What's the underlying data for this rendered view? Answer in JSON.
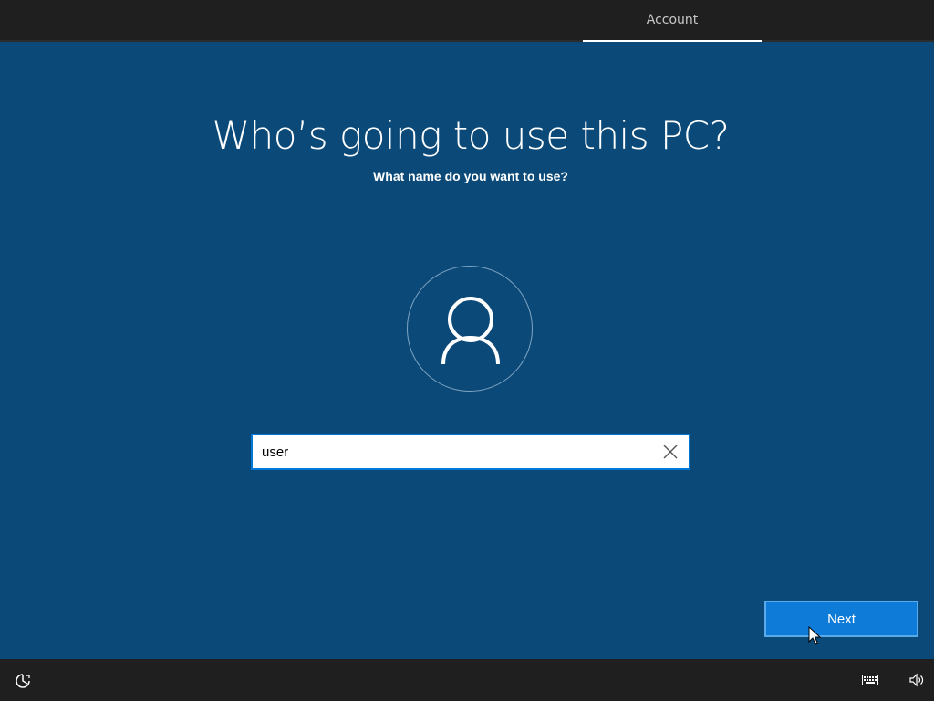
{
  "header": {
    "tabs": [
      {
        "label": "Account",
        "active": true
      }
    ]
  },
  "main": {
    "title": "Who’s going to use this PC?",
    "subtitle": "What name do you want to use?",
    "name_input": {
      "value": "user",
      "placeholder": ""
    },
    "next_label": "Next"
  },
  "icons": {
    "avatar": "person-icon",
    "clear": "close-icon",
    "ease_of_access": "ease-of-access-icon",
    "keyboard": "keyboard-icon",
    "volume": "volume-icon"
  },
  "colors": {
    "background": "#0b4a78",
    "bars": "#1f1f1f",
    "accent": "#0078d7",
    "button": "#0f7bd8"
  }
}
